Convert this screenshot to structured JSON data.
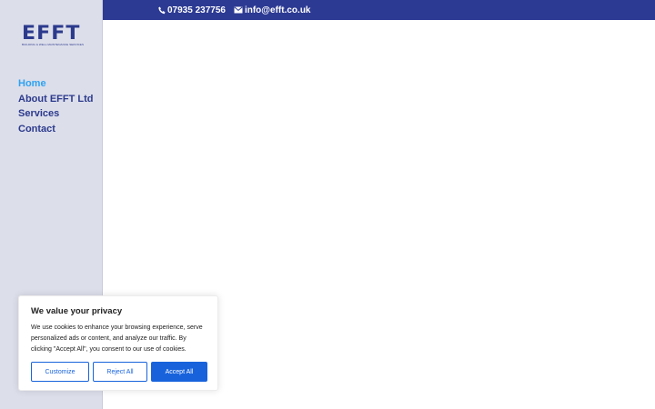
{
  "brand": {
    "logo_text": "EFFT",
    "logo_tagline": "BUILDING & WELL MAINTENANCE SERVICES",
    "color": "#2c3a8c"
  },
  "topbar": {
    "phone": "07935 237756",
    "email": "info@efft.co.uk",
    "background": "#2c3a93",
    "phone_icon": "phone-icon",
    "email_icon": "envelope-icon"
  },
  "nav": {
    "items": [
      {
        "label": "Home",
        "active": true
      },
      {
        "label": "About EFFT Ltd",
        "active": false
      },
      {
        "label": "Services",
        "active": false
      },
      {
        "label": "Contact",
        "active": false
      }
    ],
    "active_color": "#2ea3f2"
  },
  "cookie_banner": {
    "title": "We value your privacy",
    "text": "We use cookies to enhance your browsing experience, serve personalized ads or content, and analyze our traffic. By clicking \"Accept All\", you consent to our use of cookies.",
    "customize_label": "Customize",
    "reject_label": "Reject All",
    "accept_label": "Accept All",
    "accent": "#1863dc"
  }
}
